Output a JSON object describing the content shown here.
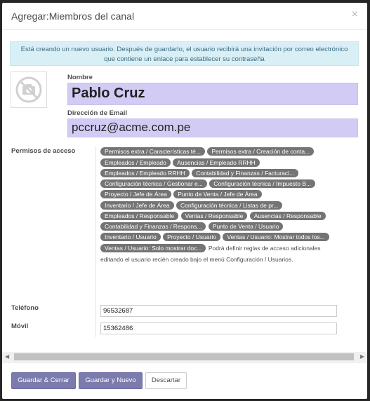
{
  "dialog": {
    "title": "Agregar:Miembros del canal",
    "close_icon": "×"
  },
  "alert": {
    "text": "Está creando un nuevo usuario. Después de guardarlo, el usuario recibirá una invitación por correo electrónico que contiene un enlace para establecer su contraseña"
  },
  "form": {
    "name_label": "Nombre",
    "name_value": "Pablo Cruz",
    "email_label": "Dirección de Email",
    "email_value": "pccruz@acme.com.pe",
    "access_label": "Permisos de acceso",
    "access_tags": [
      "Permisos extra / Características té...",
      "Permisos extra / Creación de conta...",
      "Empleados / Empleado",
      "Ausencias / Empleado RRHH",
      "Empleados / Empleado RRHH",
      "Contabilidad y Finanzas / Facturaci...",
      "Configuración técnica / Gestionar e...",
      "Configuración técnica / Impuesto B...",
      "Proyecto / Jefe de Área",
      "Punto de Venta / Jefe de Área",
      "Inventario / Jefe de Área",
      "Configuración técnica / Listas de pr...",
      "Empleados / Responsable",
      "Ventas / Responsable",
      "Ausencias / Responsable",
      "Contabilidad y Finanzas / Respons...",
      "Punto de Venta / Usuario",
      "Inventario / Usuario",
      "Proyecto / Usuario",
      "Ventas / Usuario: Mostrar todos los...",
      "Ventas / Usuario: Solo mostrar doc..."
    ],
    "access_note": "Podrá definir reglas de acceso adicionales editando el usuario recién creado bajo el menú Configuración / Usuarios.",
    "phone_label": "Teléfono",
    "phone_value": "96532687",
    "mobile_label": "Móvil",
    "mobile_value": "15362486"
  },
  "footer": {
    "save_close": "Guardar & Cerrar",
    "save_new": "Guardar y Nuevo",
    "discard": "Descartar"
  }
}
